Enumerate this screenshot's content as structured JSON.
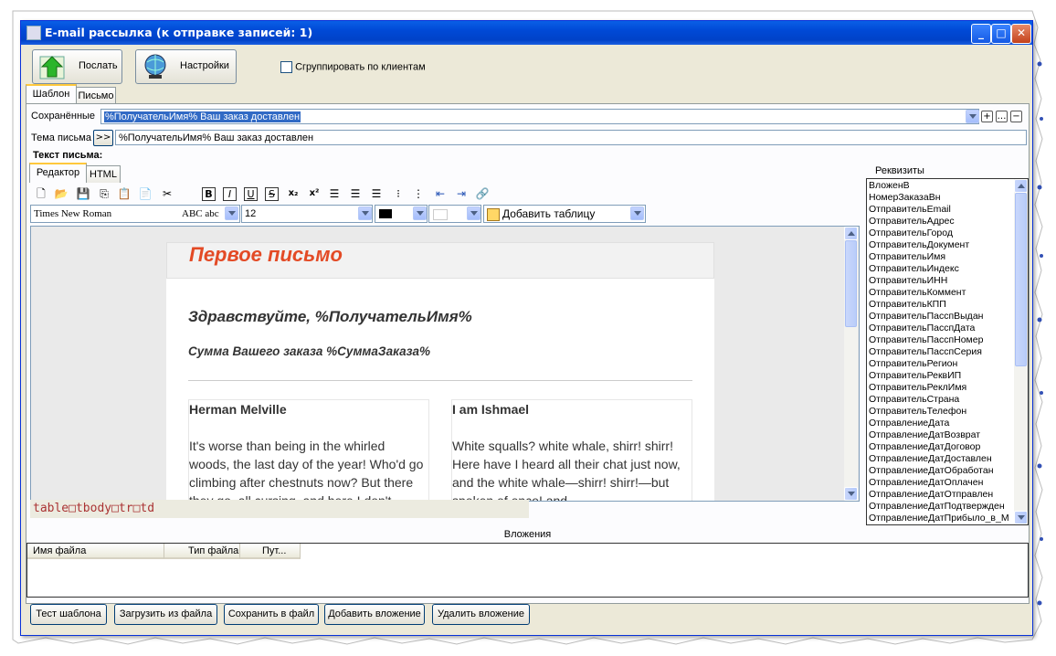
{
  "window": {
    "title": "E-mail рассылка (к отправке записей: 1)"
  },
  "toolbar": {
    "send_label": "Послать",
    "settings_label": "Настройки",
    "group_label": "Сгруппировать по клиентам",
    "group_checked": false
  },
  "tabs": {
    "template": "Шаблон",
    "letter": "Письмо"
  },
  "saved": {
    "label": "Сохранённые",
    "value": "%ПолучательИмя% Ваш заказ доставлен"
  },
  "subject": {
    "label": "Тема письма",
    "insert_btn": ">>",
    "value": "%ПолучательИмя% Ваш заказ доставлен"
  },
  "body_label": "Текст письма:",
  "editor_tabs": {
    "editor": "Редактор",
    "html": "HTML"
  },
  "format": {
    "font": "Times New Roman",
    "font_preview": "ABC abc",
    "size": "12",
    "add_table": "Добавить таблицу"
  },
  "email": {
    "header": "Первое письмо",
    "greeting": "Здравствуйте, %ПолучательИмя%",
    "sum": "Сумма Вашего заказа %СуммаЗаказа%",
    "col1_title": "Herman Melville",
    "col1_text": "It's worse than being in the whirled woods, the last day of the year! Who'd go climbing after chestnuts now? But there they go, all cursing, and here I don't.",
    "col2_title": "I am Ishmael",
    "col2_text": "White squalls? white whale, shirr! shirr! Here have I heard all their chat just now, and the white whale—shirr! shirr!—but spoken of once! and"
  },
  "path": "table□tbody□tr□td",
  "requisites": {
    "title": "Реквизиты",
    "items": [
      "ВложенВ",
      "НомерЗаказаВн",
      "ОтправительEmail",
      "ОтправительАдрес",
      "ОтправительГород",
      "ОтправительДокумент",
      "ОтправительИмя",
      "ОтправительИндекс",
      "ОтправительИНН",
      "ОтправительКоммент",
      "ОтправительКПП",
      "ОтправительПасспВыдан",
      "ОтправительПасспДата",
      "ОтправительПасспНомер",
      "ОтправительПасспСерия",
      "ОтправительРегион",
      "ОтправительРеквИП",
      "ОтправительРеклИмя",
      "ОтправительСтрана",
      "ОтправительТелефон",
      "ОтправлениеДата",
      "ОтправлениеДатВозврат",
      "ОтправлениеДатДоговор",
      "ОтправлениеДатДоставлен",
      "ОтправлениеДатОбработан",
      "ОтправлениеДатОплачен",
      "ОтправлениеДатОтправлен",
      "ОтправлениеДатПодтвержден",
      "ОтправлениеДатПрибыло_в_М"
    ]
  },
  "attachments": {
    "title": "Вложения",
    "col_name": "Имя файла",
    "col_type": "Тип файла",
    "col_path": "Пут..."
  },
  "bottom": {
    "test": "Тест шаблона",
    "load": "Загрузить из файла",
    "save": "Сохранить в файл",
    "add": "Добавить вложение",
    "remove": "Удалить вложение"
  },
  "colors": {
    "title_bar": "#0049d6",
    "header_text": "#e34a25",
    "window_bg": "#ece9d8",
    "selection": "#316ac5"
  }
}
